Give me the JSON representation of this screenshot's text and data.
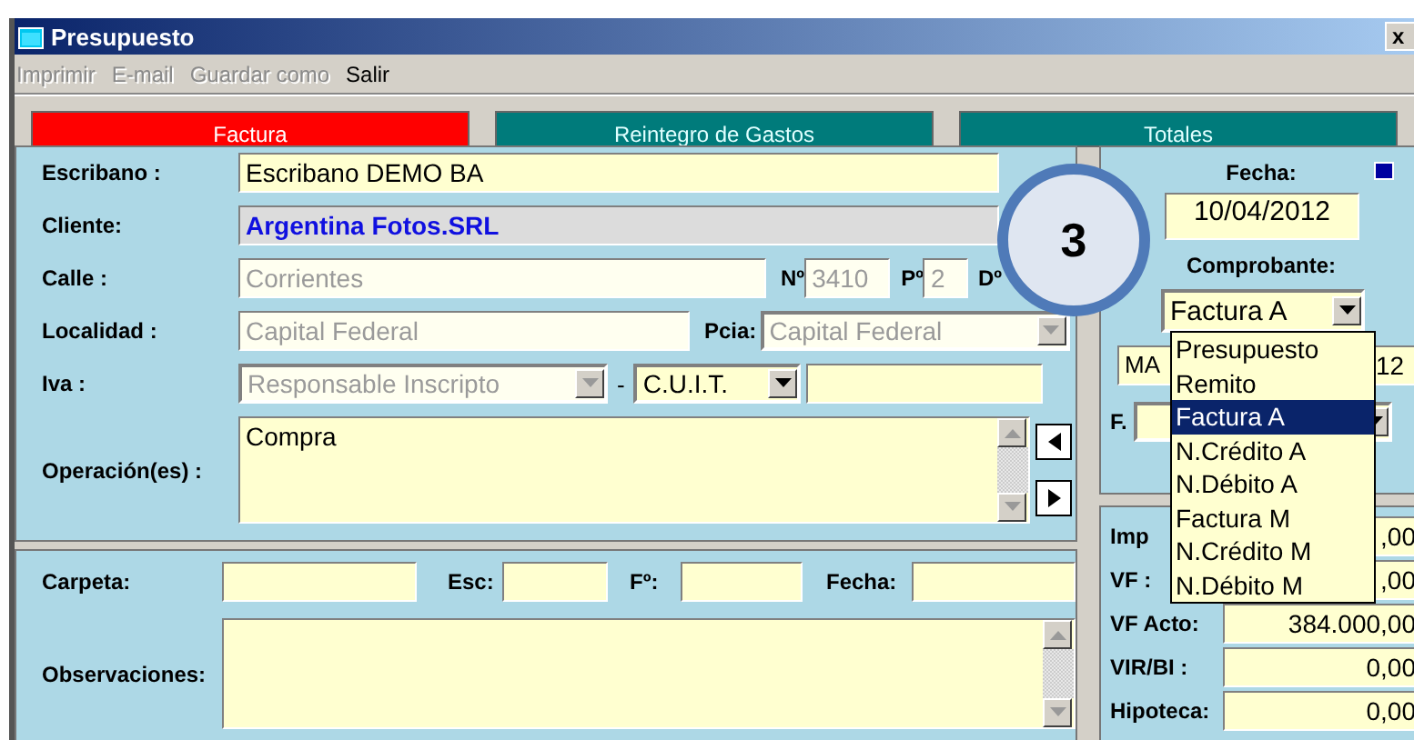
{
  "window": {
    "title": "Presupuesto",
    "close": "x"
  },
  "menu": [
    {
      "label": "Imprimir",
      "disabled": true
    },
    {
      "label": "E-mail",
      "disabled": true
    },
    {
      "label": "Guardar como",
      "disabled": true
    },
    {
      "label": "Salir",
      "disabled": false
    }
  ],
  "tabs": [
    {
      "label": "Factura",
      "selected": true
    },
    {
      "label": "Reintegro de Gastos",
      "selected": false
    },
    {
      "label": "Totales",
      "selected": false
    }
  ],
  "party": {
    "escribano": {
      "label": "Escribano :",
      "value": "Escribano DEMO BA"
    },
    "cliente": {
      "label": "Cliente:",
      "value": "Argentina Fotos.SRL"
    },
    "calle": {
      "label": "Calle :",
      "value": "Corrientes",
      "disabled": true
    },
    "numero": {
      "label": "Nº",
      "value": "3410",
      "disabled": true
    },
    "piso": {
      "label": "Pº",
      "value": "2",
      "disabled": true
    },
    "depto": {
      "label": "Dº"
    },
    "localidad": {
      "label": "Localidad :",
      "value": "Capital Federal",
      "disabled": true
    },
    "provincia": {
      "label": "Pcia:",
      "value": "Capital Federal",
      "disabled": true
    },
    "iva": {
      "label": "Iva :",
      "value": "Responsable Inscripto",
      "disabled": true
    },
    "separator": "-",
    "doc_type": {
      "value": "C.U.I.T.",
      "disabled": false
    },
    "operaciones": {
      "label": "Operación(es) :",
      "value": "Compra"
    }
  },
  "registro": {
    "carpeta": "Carpeta:",
    "esc": "Esc:",
    "folio": "Fº:",
    "fecha": "Fecha:",
    "observaciones": "Observaciones:"
  },
  "side": {
    "fecha_label": "Fecha:",
    "fecha": "10/04/2012",
    "comprobante_label": "Comprobante:",
    "field_a": "MA",
    "field_b": "12",
    "f_label": "F.",
    "comprobante": {
      "value": "Factura A",
      "expanded": true,
      "options": [
        {
          "label": "Presupuesto",
          "selected": false
        },
        {
          "label": "Remito",
          "selected": false
        },
        {
          "label": "Factura A",
          "selected": true
        },
        {
          "label": "N.Crédito A",
          "selected": false
        },
        {
          "label": "N.Débito A",
          "selected": false
        },
        {
          "label": "Factura M",
          "selected": false
        },
        {
          "label": "N.Crédito M",
          "selected": false
        },
        {
          "label": "N.Débito M",
          "selected": false
        }
      ]
    }
  },
  "totals": [
    {
      "label": "Imp",
      "value": ",00"
    },
    {
      "label": "VF :",
      "value": ",00"
    },
    {
      "label": "VF Acto:",
      "value": "384.000,00"
    },
    {
      "label": "VIR/BI :",
      "value": "0,00"
    },
    {
      "label": "Hipoteca:",
      "value": "0,00"
    }
  ],
  "step_badge": "3"
}
